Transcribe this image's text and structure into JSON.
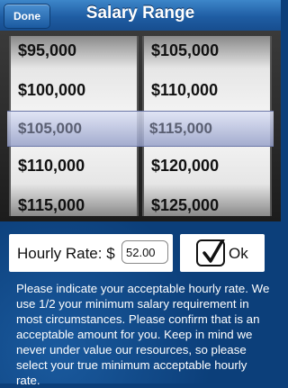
{
  "nav": {
    "done_label": "Done",
    "title": "Salary Range"
  },
  "picker": {
    "left": {
      "items": [
        "$95,000",
        "$100,000",
        "$105,000",
        "$110,000",
        "$115,000"
      ],
      "selected": "$105,000"
    },
    "right": {
      "items": [
        "$105,000",
        "$110,000",
        "$115,000",
        "$120,000",
        "$125,000"
      ],
      "selected": "$115,000"
    }
  },
  "hourly": {
    "label": "Hourly Rate:",
    "currency": "$",
    "value": "52.00"
  },
  "ok": {
    "label": "Ok",
    "checked": true
  },
  "info_text": "Please indicate your acceptable hourly rate. We use 1/2 your minimum salary requirement in most circumstances. Please confirm that is an acceptable amount for you. Keep in mind we never under value our resources, so please select your true minimum acceptable hourly rate."
}
